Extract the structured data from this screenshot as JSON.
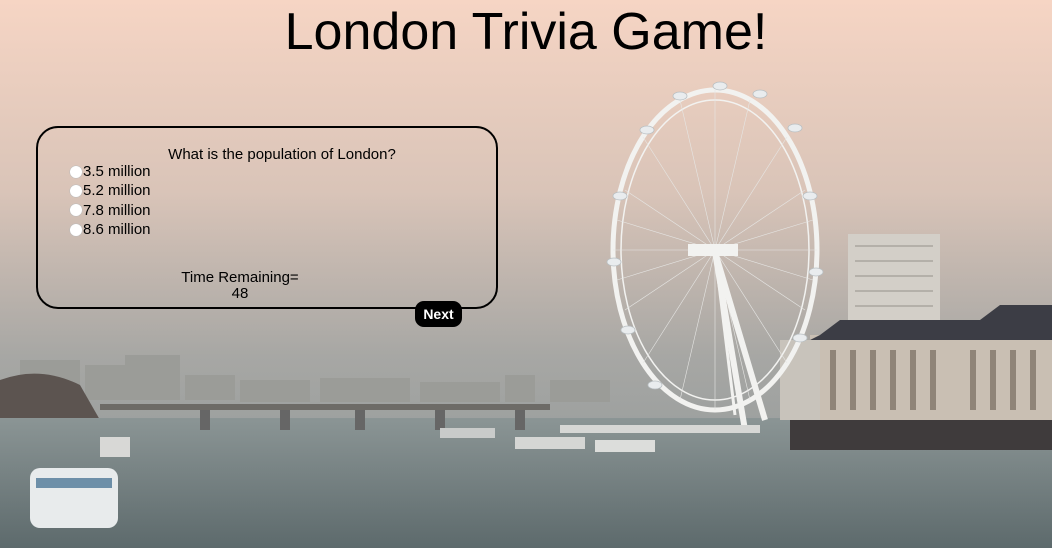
{
  "page": {
    "title": "London Trivia Game!"
  },
  "quiz": {
    "question": "What is the population of London?",
    "answers": [
      "3.5 million",
      "5.2 million",
      "7.8 million",
      "8.6 million"
    ],
    "timer_label": "Time Remaining=",
    "timer_value": "48",
    "next_label": "Next"
  },
  "colors": {
    "sky_top": "#f3d3c3",
    "sky_bottom": "#9aa0a2",
    "water": "#6f7d7f",
    "button": "#000000",
    "button_text": "#ffffff"
  },
  "icons": [
    "radio-button-icon"
  ]
}
